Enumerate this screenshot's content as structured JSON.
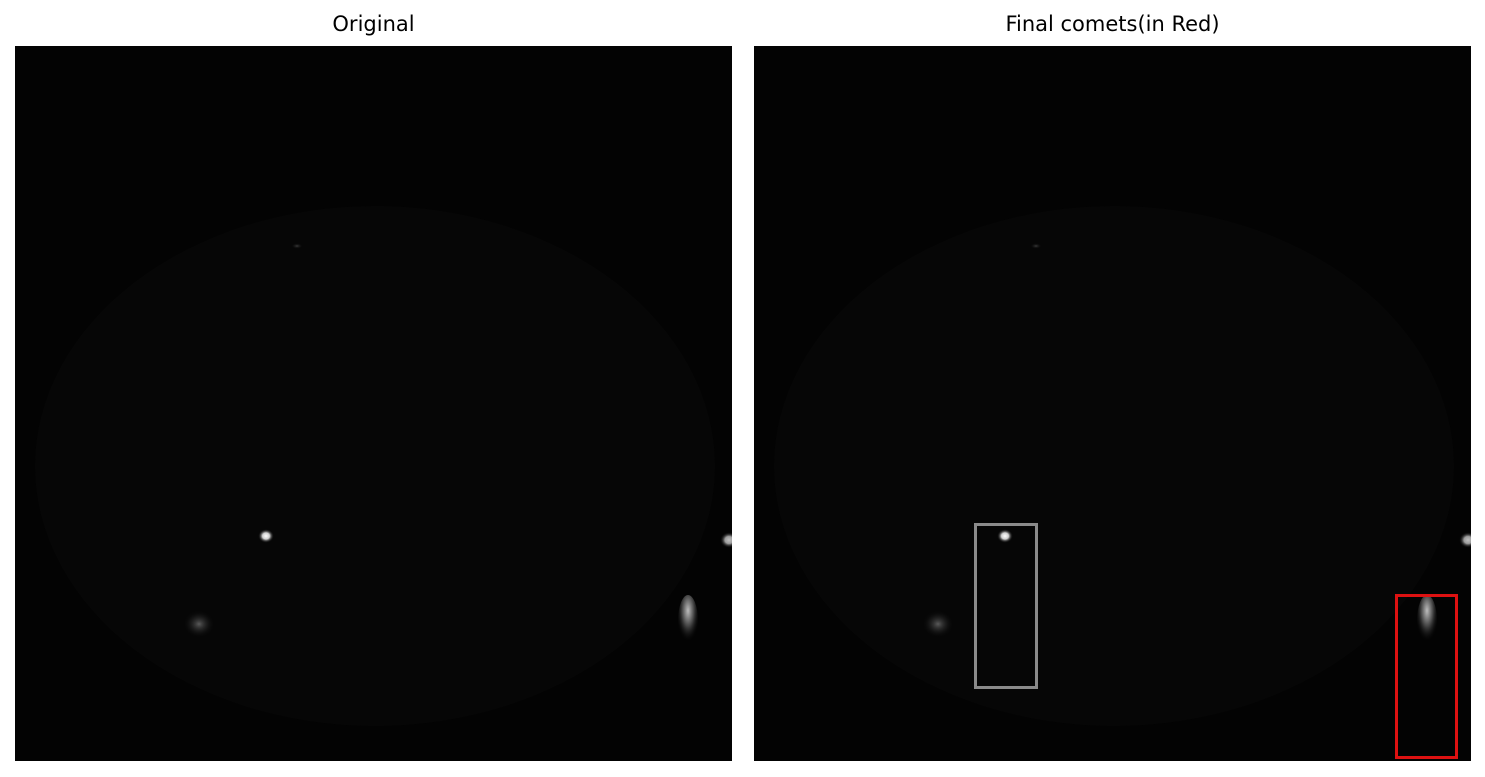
{
  "panels": [
    {
      "title": "Original",
      "image": "cell-microscopy-image"
    },
    {
      "title": "Final comets(in Red)",
      "image": "cell-microscopy-image-with-detections"
    }
  ],
  "colors": {
    "background": "#030303",
    "gray_box": "#8a8a8a",
    "red_box": "#dd1111"
  }
}
